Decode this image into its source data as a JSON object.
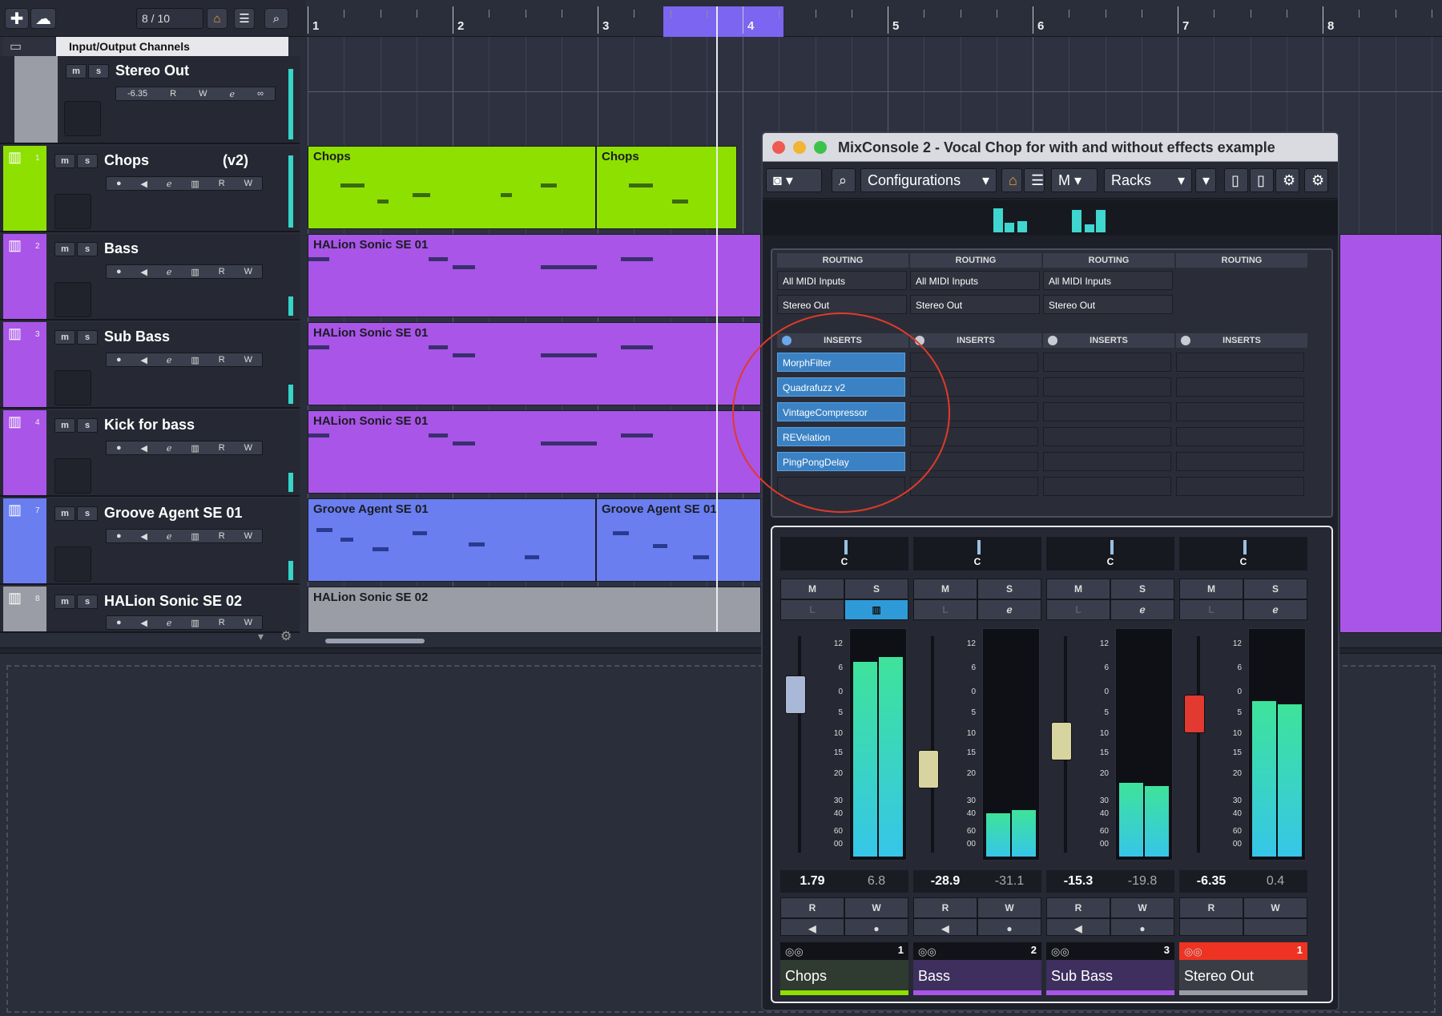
{
  "toolbar": {
    "counter": "8 / 10"
  },
  "ruler": {
    "bars": [
      "1",
      "2",
      "3",
      "4",
      "5",
      "6",
      "7",
      "8"
    ]
  },
  "io_header": "Input/Output Channels",
  "stereo_out": {
    "name": "Stereo Out",
    "volume": "-6.35"
  },
  "tracks": [
    {
      "num": "1",
      "name": "Chops",
      "version": "(v2)",
      "color": "#8ee000"
    },
    {
      "num": "2",
      "name": "Bass",
      "color": "#a955e8"
    },
    {
      "num": "3",
      "name": "Sub Bass",
      "color": "#a955e8"
    },
    {
      "num": "4",
      "name": "Kick for bass",
      "color": "#a955e8"
    },
    {
      "num": "7",
      "name": "Groove Agent SE 01",
      "color": "#6a7ef0"
    },
    {
      "num": "8",
      "name": "HALion Sonic SE 02",
      "color": "#9a9ca6"
    }
  ],
  "parts": {
    "chops_a": "Chops",
    "chops_b": "Chops",
    "bass": "HALion Sonic SE 01",
    "subbass": "HALion Sonic SE 01",
    "kick": "HALion Sonic SE 01",
    "groove_a": "Groove Agent SE 01",
    "groove_b": "Groove Agent SE 01",
    "halion2": "HALion Sonic SE 02"
  },
  "mixconsole": {
    "title": "MixConsole 2 - Vocal Chop for with and without effects example",
    "configurations": "Configurations",
    "racks": "Racks",
    "routing_label": "ROUTING",
    "inserts_label": "INSERTS",
    "routing": [
      {
        "input": "All MIDI Inputs",
        "output": "Stereo Out"
      },
      {
        "input": "All MIDI Inputs",
        "output": "Stereo Out"
      },
      {
        "input": "All MIDI Inputs",
        "output": "Stereo Out"
      }
    ],
    "inserts": [
      "MorphFilter",
      "Quadrafuzz v2",
      "VintageCompressor",
      "REVelation",
      "PingPongDelay"
    ],
    "pan_label": "C",
    "scale": [
      "12",
      "6",
      "0",
      "5",
      "10",
      "15",
      "20",
      "30",
      "40",
      "60",
      "00"
    ],
    "channels": [
      {
        "name": "Chops",
        "num": "1",
        "volume": "1.79",
        "peak": "6.8",
        "color": "#8ee000",
        "meter_level": 0.9,
        "fader_pos": 0.22
      },
      {
        "name": "Bass",
        "num": "2",
        "volume": "-28.9",
        "peak": "-31.1",
        "color": "#a955e8",
        "meter_level": 0.2,
        "fader_pos": 0.64
      },
      {
        "name": "Sub Bass",
        "num": "3",
        "volume": "-15.3",
        "peak": "-19.8",
        "color": "#a955e8",
        "meter_level": 0.34,
        "fader_pos": 0.48
      },
      {
        "name": "Stereo Out",
        "num": "1",
        "volume": "-6.35",
        "peak": "0.4",
        "color": "#ee3322",
        "meter_level": 0.72,
        "fader_pos": 0.33
      }
    ],
    "buttons": {
      "m": "M",
      "s": "S",
      "r": "R",
      "w": "W",
      "l": "L"
    }
  }
}
